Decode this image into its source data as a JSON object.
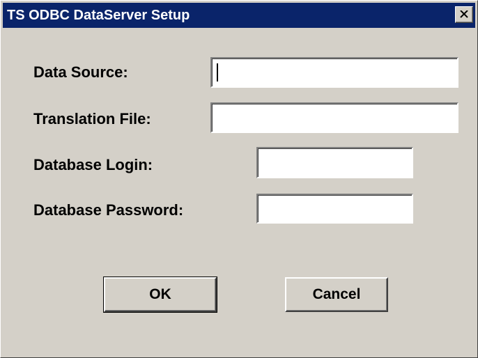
{
  "window": {
    "title": "TS ODBC DataServer Setup",
    "close_icon": "close-icon"
  },
  "form": {
    "data_source": {
      "label": "Data Source:",
      "value": ""
    },
    "translation_file": {
      "label": "Translation File:",
      "value": ""
    },
    "database_login": {
      "label": "Database Login:",
      "value": ""
    },
    "database_password": {
      "label": "Database Password:",
      "value": ""
    }
  },
  "buttons": {
    "ok_label": "OK",
    "cancel_label": "Cancel"
  },
  "colors": {
    "titlebar": "#0a246a",
    "face": "#d4d0c8"
  }
}
